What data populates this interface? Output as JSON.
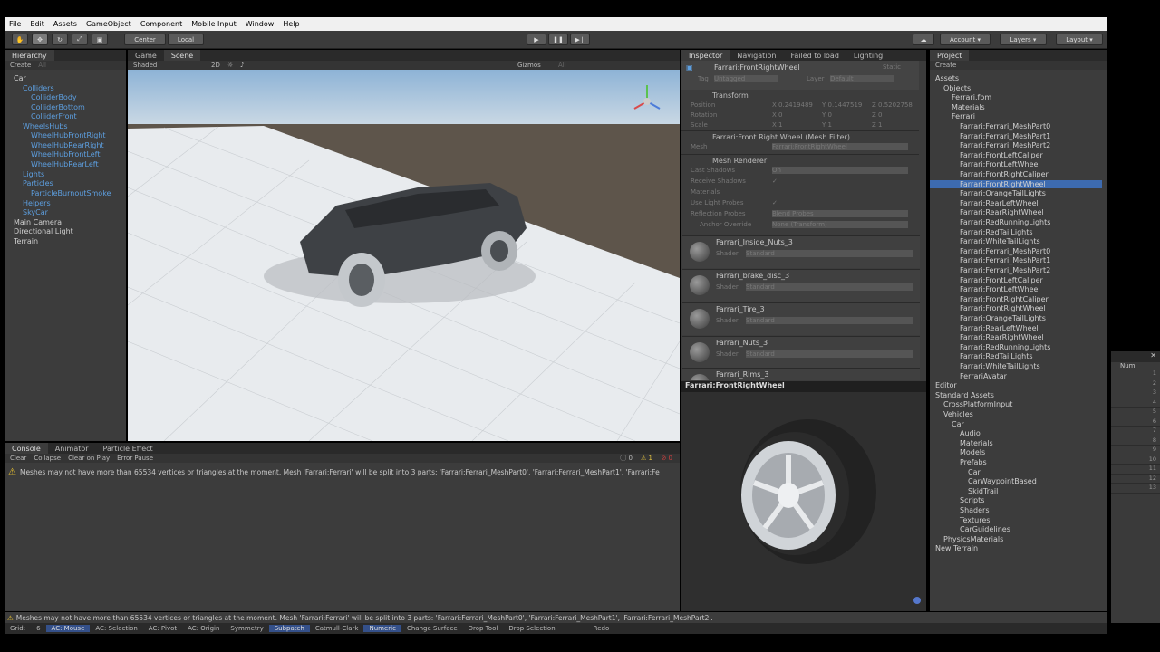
{
  "menu": [
    "File",
    "Edit",
    "Assets",
    "GameObject",
    "Component",
    "Mobile Input",
    "Window",
    "Help"
  ],
  "toolbar": {
    "center": "Center",
    "local": "Local",
    "account": "Account",
    "layers": "Layers",
    "layout": "Layout"
  },
  "hierarchy": {
    "tab": "Hierarchy",
    "create": "Create",
    "all": "All",
    "items": [
      "Car",
      "Colliders",
      "ColliderBody",
      "ColliderBottom",
      "ColliderFront",
      "WheelsHubs",
      "WheelHubFrontRight",
      "WheelHubRearRight",
      "WheelHubFrontLeft",
      "WheelHubRearLeft",
      "Lights",
      "Particles",
      "ParticleBurnoutSmoke",
      "Helpers",
      "SkyCar",
      "Main Camera",
      "Directional Light",
      "Terrain"
    ]
  },
  "scene": {
    "tab_game": "Game",
    "tab_scene": "Scene",
    "shaded": "Shaded",
    "mode_2d": "2D",
    "gizmos": "Gizmos",
    "all": "All"
  },
  "console": {
    "tabs": [
      "Console",
      "Animator",
      "Particle Effect"
    ],
    "buttons": [
      "Clear",
      "Collapse",
      "Clear on Play",
      "Error Pause"
    ],
    "counts": [
      "0",
      "1",
      "0"
    ],
    "message": "Meshes may not have more than 65534 vertices or triangles at the moment. Mesh 'Farrari:Ferrari' will be split into 3 parts: 'Farrari:Ferrari_MeshPart0', 'Farrari:Ferrari_MeshPart1', 'Farrari:Fe"
  },
  "inspector": {
    "tabs": [
      "Inspector",
      "Navigation",
      "Failed to load",
      "Lighting"
    ],
    "object_name": "Farrari:FrontRightWheel",
    "static": "Static",
    "tag_label": "Tag",
    "tag_value": "Untagged",
    "layer_label": "Layer",
    "layer_value": "Default",
    "transform": "Transform",
    "position": "Position",
    "rotation": "Rotation",
    "scale": "Scale",
    "pos_x": "0.2419489",
    "pos_y": "0.1447519",
    "pos_z": "0.5202758",
    "rot_x": "0",
    "rot_y": "0",
    "rot_z": "0",
    "scl_x": "1",
    "scl_y": "1",
    "scl_z": "1",
    "x": "X",
    "y": "Y",
    "z": "Z",
    "mesh_filter": "Farrari:Front Right Wheel (Mesh Filter)",
    "mesh_label": "Mesh",
    "mesh_value": "Farrari:FrontRightWheel",
    "mesh_renderer": "Mesh Renderer",
    "cast_shadows": "Cast Shadows",
    "cast_value": "On",
    "receive_shadows": "Receive Shadows",
    "materials": "Materials",
    "use_light_probes": "Use Light Probes",
    "reflection_probes": "Reflection Probes",
    "reflection_value": "Blend Probes",
    "anchor_override": "Anchor Override",
    "anchor_value": "None (Transform)",
    "mats": [
      "Farrari_Inside_Nuts_3",
      "Farrari_brake_disc_3",
      "Farrari_Tire_3",
      "Farrari_Nuts_3",
      "Farrari_Rims_3"
    ],
    "shader_label": "Shader",
    "shader_value": "Standard",
    "preview_name": "Farrari:FrontRightWheel"
  },
  "project": {
    "tab": "Project",
    "create": "Create",
    "items": [
      "Assets",
      "Objects",
      "Ferrari.fbm",
      "Materials",
      "Ferrari",
      "Farrari:Ferrari_MeshPart0",
      "Farrari:Ferrari_MeshPart1",
      "Farrari:Ferrari_MeshPart2",
      "Farrari:FrontLeftCaliper",
      "Farrari:FrontLeftWheel",
      "Farrari:FrontRightCaliper",
      "Farrari:FrontRightWheel",
      "Farrari:OrangeTailLights",
      "Farrari:RearLeftWheel",
      "Farrari:RearRightWheel",
      "Farrari:RedRunningLights",
      "Farrari:RedTailLights",
      "Farrari:WhiteTailLights",
      "Farrari:Ferrari_MeshPart0",
      "Farrari:Ferrari_MeshPart1",
      "Farrari:Ferrari_MeshPart2",
      "Farrari:FrontLeftCaliper",
      "Farrari:FrontLeftWheel",
      "Farrari:FrontRightCaliper",
      "Farrari:FrontRightWheel",
      "Farrari:OrangeTailLights",
      "Farrari:RearLeftWheel",
      "Farrari:RearRightWheel",
      "Farrari:RedRunningLights",
      "Farrari:RedTailLights",
      "Farrari:WhiteTailLights",
      "FerrariAvatar",
      "Editor",
      "Standard Assets",
      "CrossPlatformInput",
      "Vehicles",
      "Car",
      "Audio",
      "Materials",
      "Models",
      "Prefabs",
      "Car",
      "CarWaypointBased",
      "SkidTrail",
      "Scripts",
      "Shaders",
      "Textures",
      "CarGuidelines",
      "PhysicsMaterials",
      "New Terrain"
    ]
  },
  "status": {
    "message": "Meshes may not have more than 65534 vertices or triangles at the moment. Mesh 'Farrari:Ferrari' will be split into 3 parts: 'Farrari:Ferrari_MeshPart0', 'Farrari:Ferrari_MeshPart1', 'Farrari:Ferrari_MeshPart2'.",
    "items": [
      "Grid:",
      "6",
      "AC: Mouse",
      "AC: Selection",
      "AC: Pivot",
      "AC: Origin",
      "Symmetry",
      "Subpatch",
      "Catmull-Clark",
      "Numeric",
      "Change Surface",
      "Drop Tool",
      "Drop Selection",
      "Redo"
    ]
  },
  "right_panel": {
    "num": "Num",
    "rows": [
      "1",
      "2",
      "3",
      "4",
      "5",
      "6",
      "7",
      "8",
      "9",
      "10",
      "11",
      "12",
      "13"
    ]
  }
}
